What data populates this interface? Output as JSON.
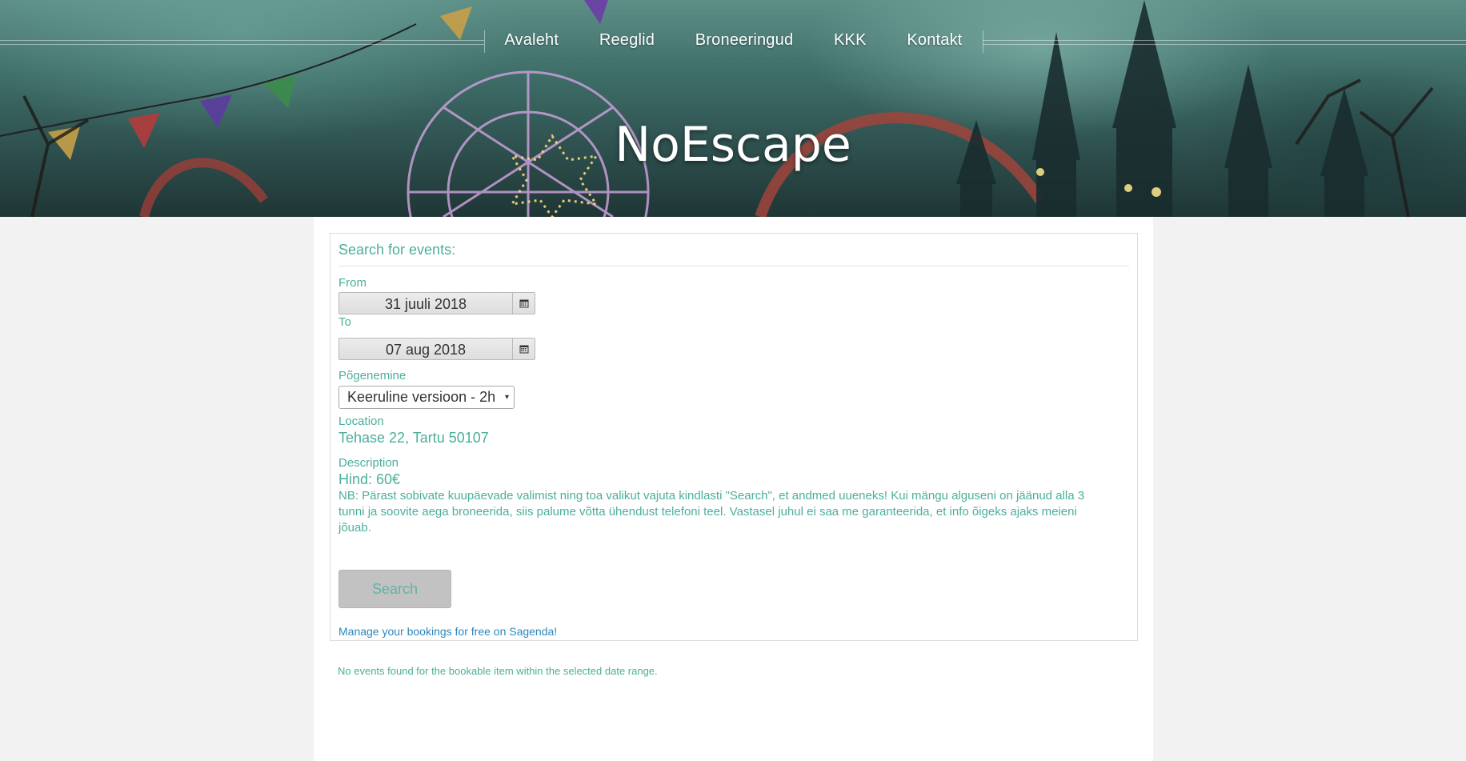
{
  "nav": {
    "items": [
      "Avaleht",
      "Reeglid",
      "Broneeringud",
      "KKK",
      "Kontakt"
    ]
  },
  "site": {
    "title": "NoEscape"
  },
  "booking": {
    "heading": "Search for events:",
    "from_label": "From",
    "from_value": "31 juuli 2018",
    "to_label": "To",
    "to_value": "07 aug 2018",
    "escape_label": "Põgenemine",
    "escape_selected": "Keeruline versioon - 2h",
    "location_label": "Location",
    "location_value": "Tehase 22, Tartu 50107",
    "description_label": "Description",
    "price": "Hind: 60€",
    "note": "NB: Pärast sobivate kuupäevade valimist ning toa valikut vajuta kindlasti \"Search\", et andmed uueneks! Kui mängu alguseni on jäänud alla 3 tunni ja soovite aega broneerida, siis palume võtta ühendust telefoni teel. Vastasel juhul ei saa me garanteerida, et info õigeks ajaks meieni jõuab.",
    "search_label": "Search",
    "sagenda_link": "Manage your bookings for free on Sagenda!"
  },
  "results": {
    "empty_message": "No events found for the bookable item within the selected date range."
  },
  "icons": {
    "calendar": "calendar-icon",
    "dropdown": "chevron-down-icon"
  },
  "colors": {
    "accent": "#4aaf9b",
    "link": "#2c87bf",
    "button_bg": "#c2c2c2"
  }
}
